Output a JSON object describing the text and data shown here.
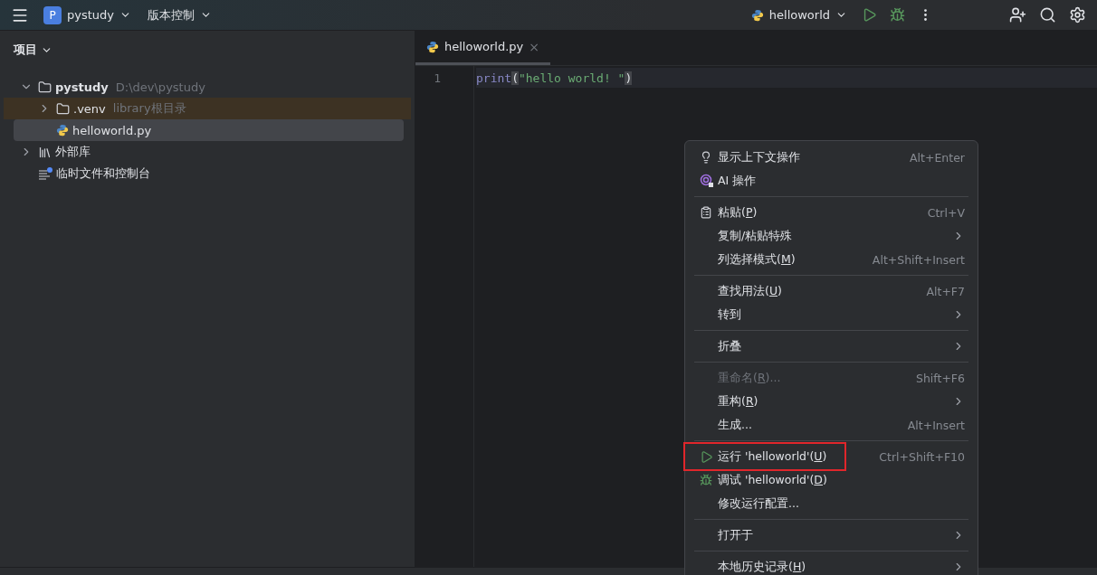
{
  "toolbar": {
    "project_letter": "P",
    "project": "pystudy",
    "vcs": "版本控制",
    "run_config": "helloworld"
  },
  "project_panel": {
    "title": "项目",
    "tree": [
      {
        "kind": "folder",
        "name": "pystudy",
        "hint": "D:\\dev\\pystudy",
        "expanded": true,
        "selected": false,
        "bold": true,
        "children": [
          {
            "kind": "folder",
            "name": ".venv",
            "hint": "library根目录",
            "expanded": false,
            "selected": false,
            "excluded": true
          },
          {
            "kind": "python",
            "name": "helloworld.py",
            "selected": true
          }
        ]
      },
      {
        "kind": "library",
        "name": "外部库",
        "expanded": false,
        "selected": false
      },
      {
        "kind": "scratch",
        "name": "临时文件和控制台",
        "selected": false
      }
    ]
  },
  "tabs": [
    {
      "name": "helloworld.py",
      "selected": true,
      "close": "×"
    }
  ],
  "editor": {
    "lines": [
      {
        "number": "1",
        "func": "print",
        "open": "(",
        "string": "\"hello world! \"",
        "close": ")"
      }
    ]
  },
  "context_menu": [
    {
      "kind": "bulb",
      "label": [
        "显示上下文操作"
      ],
      "shortcut": "Alt+Enter",
      "disabled": false
    },
    {
      "kind": "ai",
      "label": [
        "AI 操作"
      ],
      "disabled": false
    },
    {
      "kind": "separator"
    },
    {
      "kind": "paste",
      "label": [
        "粘贴(",
        "P",
        ")"
      ],
      "shortcut": "Ctrl+V",
      "disabled": false
    },
    {
      "kind": "plain",
      "label": [
        "复制/粘贴特殊"
      ],
      "submenu": true,
      "disabled": false
    },
    {
      "kind": "plain",
      "label": [
        "列选择模式(",
        "M",
        ")"
      ],
      "shortcut": "Alt+Shift+Insert",
      "disabled": false
    },
    {
      "kind": "separator"
    },
    {
      "kind": "plain",
      "label": [
        "查找用法(",
        "U",
        ")"
      ],
      "shortcut": "Alt+F7",
      "disabled": false
    },
    {
      "kind": "plain",
      "label": [
        "转到"
      ],
      "submenu": true,
      "disabled": false
    },
    {
      "kind": "separator"
    },
    {
      "kind": "plain",
      "label": [
        "折叠"
      ],
      "submenu": true,
      "disabled": false
    },
    {
      "kind": "separator"
    },
    {
      "kind": "plain",
      "label": [
        "重命名(",
        "R",
        ")..."
      ],
      "shortcut": "Shift+F6",
      "disabled": true
    },
    {
      "kind": "plain",
      "label": [
        "重构(",
        "R",
        ")"
      ],
      "submenu": true,
      "disabled": false
    },
    {
      "kind": "plain",
      "label": [
        "生成..."
      ],
      "shortcut": "Alt+Insert",
      "disabled": false
    },
    {
      "kind": "separator"
    },
    {
      "kind": "run",
      "label": [
        "运行 'helloworld'(",
        "U",
        ")"
      ],
      "shortcut": "Ctrl+Shift+F10",
      "disabled": false,
      "highlighted": true
    },
    {
      "kind": "debug",
      "label": [
        "调试 'helloworld'(",
        "D",
        ")"
      ],
      "disabled": false
    },
    {
      "kind": "plain",
      "label": [
        "修改运行配置..."
      ],
      "disabled": false
    },
    {
      "kind": "separator"
    },
    {
      "kind": "plain",
      "label": [
        "打开于"
      ],
      "submenu": true,
      "disabled": false
    },
    {
      "kind": "separator"
    },
    {
      "kind": "plain",
      "label": [
        "本地历史记录(",
        "H",
        ")"
      ],
      "submenu": true,
      "disabled": false
    }
  ]
}
